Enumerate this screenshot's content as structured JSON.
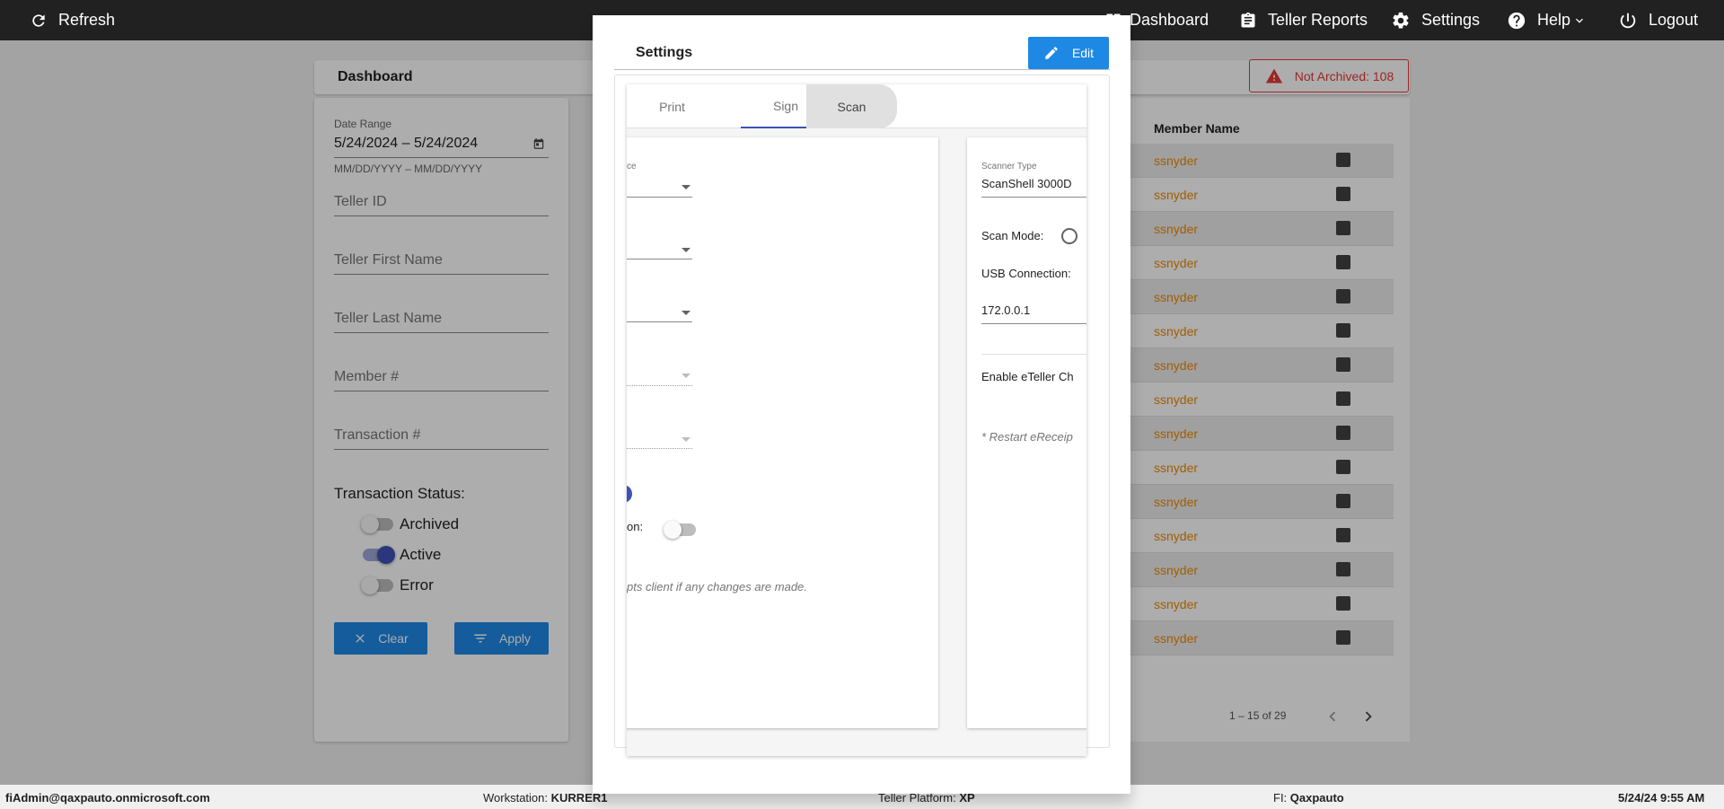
{
  "topbar": {
    "refresh": "Refresh",
    "dashboard": "Dashboard",
    "teller_reports": "Teller Reports",
    "settings": "Settings",
    "help": "Help",
    "logout": "Logout"
  },
  "dashboard": {
    "title": "Dashboard",
    "badge": "Not Archived: 108",
    "filters": {
      "date_range_label": "Date Range",
      "date_range_value": "5/24/2024 – 5/24/2024",
      "date_hint": "MM/DD/YYYY – MM/DD/YYYY",
      "teller_id": "Teller ID",
      "teller_first_name": "Teller First Name",
      "teller_last_name": "Teller Last Name",
      "member_no": "Member #",
      "transaction_no": "Transaction #",
      "status_label": "Transaction Status:",
      "statuses": [
        {
          "label": "Archived",
          "on": false
        },
        {
          "label": "Active",
          "on": true
        },
        {
          "label": "Error",
          "on": false
        }
      ],
      "clear": "Clear",
      "apply": "Apply"
    },
    "table": {
      "column_member_name": "Member Name",
      "rows": [
        "ssnyder",
        "ssnyder",
        "ssnyder",
        "ssnyder",
        "ssnyder",
        "ssnyder",
        "ssnyder",
        "ssnyder",
        "ssnyder",
        "ssnyder",
        "ssnyder",
        "ssnyder",
        "ssnyder",
        "ssnyder",
        "ssnyder"
      ],
      "pager": "1 – 15 of 29"
    }
  },
  "modal": {
    "title": "Settings",
    "edit": "Edit",
    "tabs": [
      "Print",
      "Sign",
      "Scan"
    ],
    "left_card": {
      "field_label_fragment": "ce",
      "toggle_label_fragment": "on:",
      "note_fragment": "pts client if any changes are made."
    },
    "right_card": {
      "scanner_type_label": "Scanner Type",
      "scanner_type_value": "ScanShell 3000D",
      "scan_mode_label": "Scan Mode:",
      "usb_connection_label": "USB Connection:",
      "ip_value": "172.0.0.1",
      "enable_label": "Enable eTeller Ch",
      "restart_note": "* Restart eReceip"
    }
  },
  "statusbar": {
    "user": "fiAdmin@qaxpauto.onmicrosoft.com",
    "workstation_label": "Workstation:",
    "workstation": "KURRER1",
    "platform_label": "Teller Platform:",
    "platform": "XP",
    "fi_label": "FI:",
    "fi": "Qaxpauto",
    "datetime": "5/24/24 9:55 AM"
  }
}
